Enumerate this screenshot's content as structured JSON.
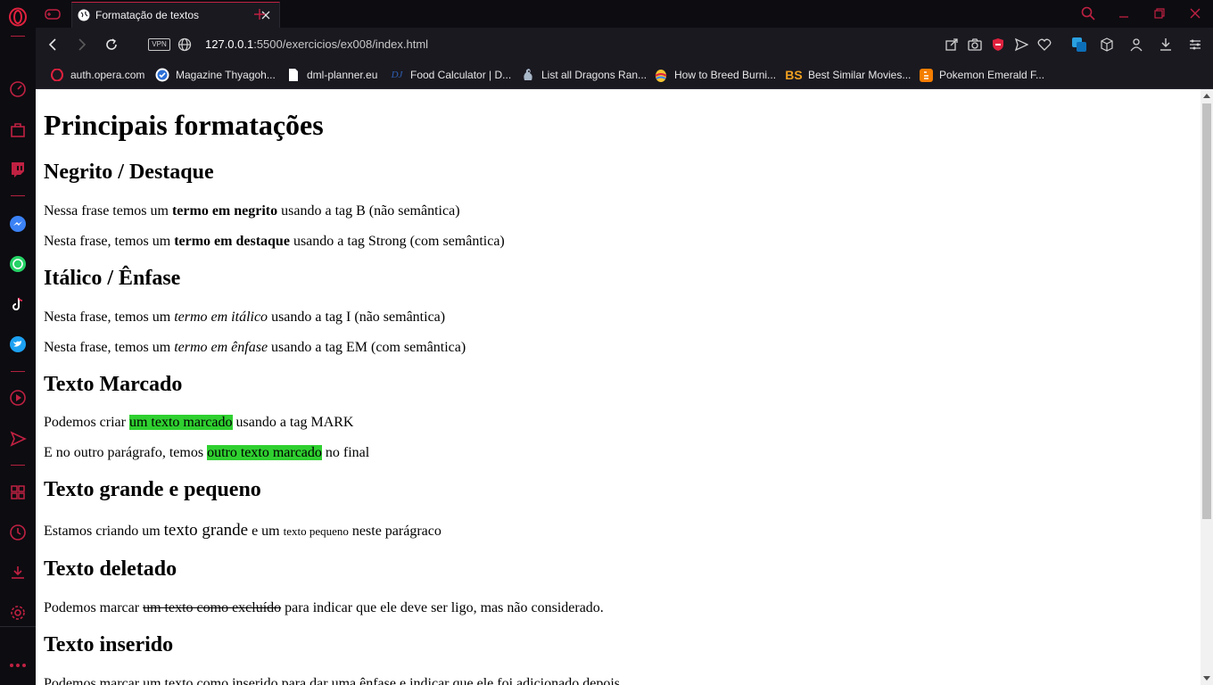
{
  "browser": {
    "tab": {
      "title": "Formatação de textos"
    },
    "address": {
      "vpn_label": "VPN",
      "host": "127.0.0.1",
      "path": ":5500/exercicios/ex008/index.html"
    },
    "bookmarks": [
      {
        "label": "auth.opera.com",
        "icon": "opera-icon"
      },
      {
        "label": "Magazine Thyagoh...",
        "icon": "check-badge-icon"
      },
      {
        "label": "dml-planner.eu",
        "icon": "file-icon"
      },
      {
        "label": "Food Calculator | D...",
        "icon": "dj-logo-icon",
        "icon_text": "DJ"
      },
      {
        "label": "List all Dragons Ran...",
        "icon": "dragon-icon"
      },
      {
        "label": "How to Breed Burni...",
        "icon": "colorful-egg-icon"
      },
      {
        "label": "Best Similar Movies...",
        "icon": "bs-logo-icon",
        "icon_text": "BS"
      },
      {
        "label": "Pokemon Emerald F...",
        "icon": "blogger-icon"
      }
    ],
    "colors": {
      "accent": "#c02142",
      "chrome": "#1a1920",
      "mark": "#2fd030"
    }
  },
  "page": {
    "h1": "Principais formatações",
    "sections": [
      {
        "heading": "Negrito / Destaque",
        "paragraphs": [
          {
            "before": "Nessa frase temos um ",
            "emph": "termo em negrito",
            "after": " usando a tag B (não semântica)"
          },
          {
            "before": "Nesta frase, temos um ",
            "emph": "termo em destaque",
            "after": " usando a tag Strong (com semântica)"
          }
        ]
      },
      {
        "heading": "Itálico / Ênfase",
        "paragraphs": [
          {
            "before": "Nesta frase, temos um ",
            "emph": "termo em itálico",
            "after": " usando a tag I (não semântica)"
          },
          {
            "before": "Nesta frase, temos um ",
            "emph": "termo em ênfase",
            "after": " usando a tag EM (com semântica)"
          }
        ]
      },
      {
        "heading": "Texto Marcado",
        "paragraphs": [
          {
            "before": "Podemos criar ",
            "emph": "um texto marcado",
            "after": " usando a tag MARK"
          },
          {
            "before": "E no outro parágrafo, temos ",
            "emph": "outro texto marcado",
            "after": " no final"
          }
        ]
      },
      {
        "heading": "Texto grande e pequeno",
        "paragraph": {
          "p1": "Estamos criando um ",
          "big": "texto grande",
          "p2": " e um ",
          "small": "texto pequeno",
          "p3": " neste parágraco"
        }
      },
      {
        "heading": "Texto deletado",
        "paragraph": {
          "before": "Podemos marcar ",
          "deleted": "um texto como excluído",
          "after": " para indicar que ele deve ser ligo, mas não considerado."
        }
      },
      {
        "heading": "Texto inserido",
        "paragraph": {
          "text": "Podemos marcar um texto como inserido para dar uma ênfase e indicar que ele foi adicionado depois"
        }
      }
    ]
  }
}
